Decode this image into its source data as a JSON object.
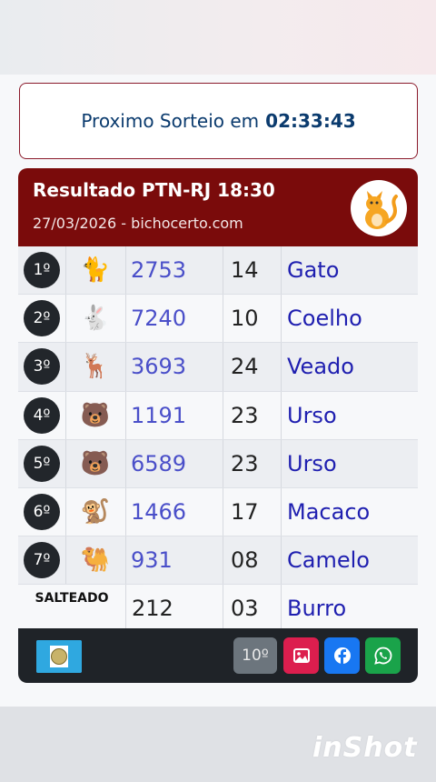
{
  "countdown": {
    "label": "Proximo Sorteio em",
    "time": "02:33:43"
  },
  "result": {
    "title": "Resultado PTN-RJ 18:30",
    "subtitle": "27/03/2026 - bichocerto.com",
    "rows": [
      {
        "pos": "1º",
        "icon": "cat-icon",
        "emoji": "🐈",
        "number": "2753",
        "group": "14",
        "animal": "Gato"
      },
      {
        "pos": "2º",
        "icon": "rabbit-icon",
        "emoji": "🐇",
        "number": "7240",
        "group": "10",
        "animal": "Coelho"
      },
      {
        "pos": "3º",
        "icon": "deer-icon",
        "emoji": "🦌",
        "number": "3693",
        "group": "24",
        "animal": "Veado"
      },
      {
        "pos": "4º",
        "icon": "bear-icon",
        "emoji": "🐻",
        "number": "1191",
        "group": "23",
        "animal": "Urso"
      },
      {
        "pos": "5º",
        "icon": "bear-icon",
        "emoji": "🐻",
        "number": "6589",
        "group": "23",
        "animal": "Urso"
      },
      {
        "pos": "6º",
        "icon": "monkey-icon",
        "emoji": "🐒",
        "number": "1466",
        "group": "17",
        "animal": "Macaco"
      },
      {
        "pos": "7º",
        "icon": "camel-icon",
        "emoji": "🐫",
        "number": "931",
        "group": "08",
        "animal": "Camelo"
      }
    ],
    "salteado": {
      "label": "SALTEADO",
      "number": "212",
      "group": "03",
      "animal": "Burro"
    }
  },
  "footer": {
    "tenth_label": "10º"
  },
  "watermark": "inShot"
}
